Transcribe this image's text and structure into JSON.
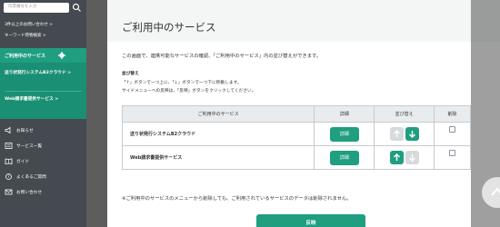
{
  "sidebar": {
    "search_placeholder": "伝票番号を入力",
    "links": [
      "3件以上のお問い合わせ >",
      "キーワード荷物検索 >"
    ],
    "active_section": {
      "label": "ご利用中のサービス",
      "services": [
        "送り状発行システムB2クラウド >",
        "Web請求書提供サービス >"
      ]
    },
    "nav": [
      {
        "label": "お知らせ",
        "icon": "speaker-icon"
      },
      {
        "label": "サービス一覧",
        "icon": "list-icon"
      },
      {
        "label": "ガイド",
        "icon": "guide-icon"
      },
      {
        "label": "よくあるご質問",
        "icon": "help-icon"
      },
      {
        "label": "お問い合わせ",
        "icon": "mail-icon"
      }
    ]
  },
  "main": {
    "title": "ご利用中のサービス",
    "intro": "この画面で、連携可能なサービスの確認、「ご利用中のサービス」内の並び替えができます。",
    "sort_heading": "並び替え",
    "sort_lines": [
      "「↑」ボタンで一つ上に、「↓」ボタンで一つ下に移動します。",
      "サイドメニューへの反映は、「反映」ボタンをクリックしてください。"
    ],
    "table": {
      "headers": [
        "ご利用中のサービス",
        "詳細",
        "並び替え",
        "削除"
      ],
      "rows": [
        {
          "name": "送り状発行システムB2クラウド",
          "detail": "詳細",
          "up_enabled": false,
          "down_enabled": true,
          "deleted": false
        },
        {
          "name": "Web請求書提供サービス",
          "detail": "詳細",
          "up_enabled": true,
          "down_enabled": false,
          "deleted": false
        }
      ]
    },
    "note": "※ご利用中のサービスのメニューから削除しても、ご利用されているサービスのデータは削除されません。",
    "apply_label": "反映"
  },
  "colors": {
    "accent": "#1f9e80",
    "sidebar_bg": "#444a4f",
    "disabled": "#d6dadd"
  }
}
